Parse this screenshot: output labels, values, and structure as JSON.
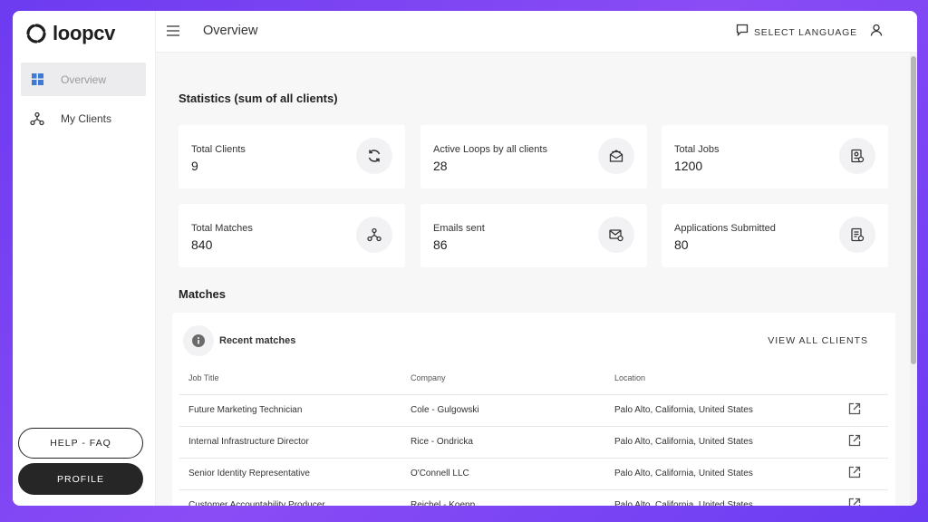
{
  "brand": {
    "name": "loopcv",
    "logo_icon": "loop-logo-icon"
  },
  "sidebar": {
    "items": [
      {
        "label": "Overview",
        "icon": "dashboard-grid-icon",
        "active": true
      },
      {
        "label": "My Clients",
        "icon": "network-nodes-icon",
        "active": false
      }
    ],
    "help_label": "HELP - FAQ",
    "profile_label": "PROFILE"
  },
  "topbar": {
    "title": "Overview",
    "language_label": "SELECT LANGUAGE",
    "menu_icon": "hamburger-menu-icon",
    "language_icon": "message-square-icon",
    "user_icon": "user-icon"
  },
  "stats": {
    "title": "Statistics (sum of all clients)",
    "cards": [
      {
        "label": "Total Clients",
        "value": "9",
        "icon": "refresh-icon"
      },
      {
        "label": "Active Loops by all clients",
        "value": "28",
        "icon": "envelope-open-icon"
      },
      {
        "label": "Total Jobs",
        "value": "1200",
        "icon": "job-badge-icon"
      },
      {
        "label": "Total Matches",
        "value": "840",
        "icon": "network-nodes-icon"
      },
      {
        "label": "Emails sent",
        "value": "86",
        "icon": "email-check-icon"
      },
      {
        "label": "Applications Submitted",
        "value": "80",
        "icon": "document-check-icon"
      }
    ]
  },
  "matches": {
    "title": "Matches",
    "recent_title": "Recent matches",
    "view_all_label": "VIEW ALL CLIENTS",
    "columns": [
      "Job Title",
      "Company",
      "Location"
    ],
    "rows": [
      {
        "job": "Future Marketing Technician",
        "company": "Cole - Gulgowski",
        "location": "Palo Alto, California, United States"
      },
      {
        "job": "Internal Infrastructure Director",
        "company": "Rice - Ondricka",
        "location": "Palo Alto, California, United States"
      },
      {
        "job": "Senior Identity Representative",
        "company": "O'Connell LLC",
        "location": "Palo Alto, California, United States"
      },
      {
        "job": "Customer Accountability Producer",
        "company": "Reichel - Koepp",
        "location": "Palo Alto, California, United States"
      }
    ]
  },
  "colors": {
    "background": "#7a45f3",
    "accent": "#262626",
    "active_icon": "#3f7bd6"
  }
}
